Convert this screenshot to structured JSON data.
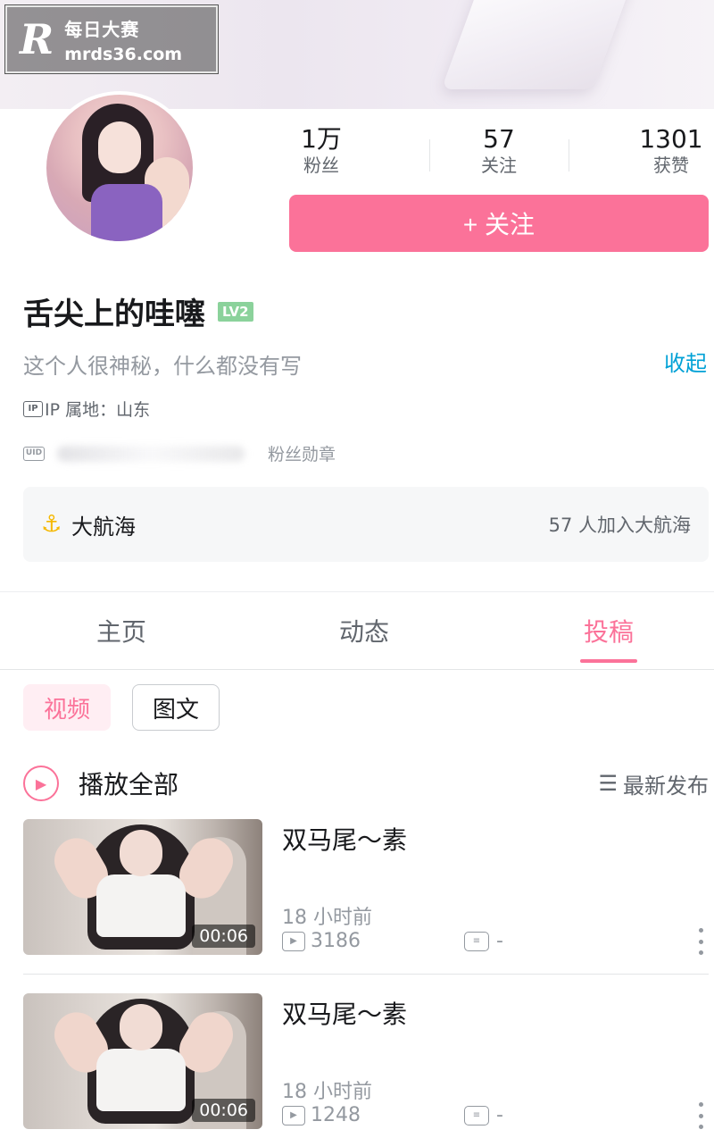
{
  "watermark": {
    "logo": "R",
    "line1": "每日大赛",
    "line2": "mrds36.com"
  },
  "profile": {
    "name": "舌尖上的哇噻",
    "level": "LV2",
    "bio": "这个人很神秘，什么都没有写",
    "collapse_label": "收起",
    "ip_icon": "IP",
    "ip_location": "IP 属地：山东",
    "uid_icon": "UID",
    "fans_medal": "粉丝勋章"
  },
  "stats": [
    {
      "value": "1万",
      "label": "粉丝"
    },
    {
      "value": "57",
      "label": "关注"
    },
    {
      "value": "1301",
      "label": "获赞"
    }
  ],
  "follow_button": "+ 关注",
  "guard": {
    "icon": "anchor-icon",
    "title": "大航海",
    "count": "57 人加入大航海"
  },
  "tabs": [
    {
      "label": "主页",
      "active": false
    },
    {
      "label": "动态",
      "active": false
    },
    {
      "label": "投稿",
      "active": true
    }
  ],
  "sub_tabs": [
    {
      "label": "视频",
      "active": true
    },
    {
      "label": "图文",
      "active": false
    }
  ],
  "play_all": {
    "label": "播放全部",
    "sort_icon": "☰",
    "sort_label": "最新发布"
  },
  "videos": [
    {
      "title": "双马尾～素",
      "duration": "00:06",
      "time": "18 小时前",
      "plays": "3186",
      "comments": "-"
    },
    {
      "title": "双马尾～素",
      "duration": "00:06",
      "time": "18 小时前",
      "plays": "1248",
      "comments": "-"
    }
  ],
  "colors": {
    "accent": "#fb7299",
    "link": "#00a1d6",
    "level": "#8bd29b",
    "anchor": "#f5b800"
  }
}
